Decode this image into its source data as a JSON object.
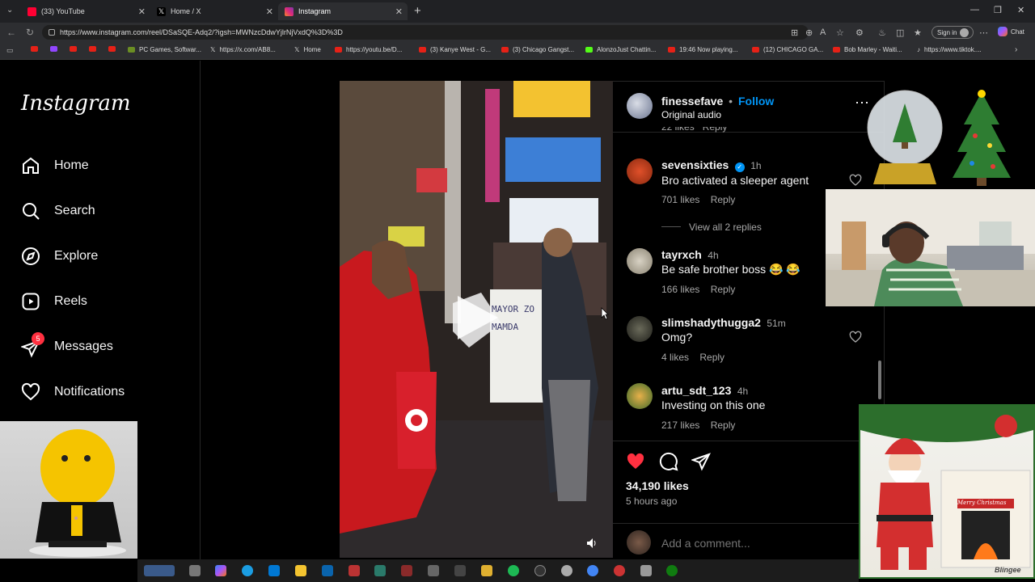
{
  "browser": {
    "tabs": [
      {
        "label": "(33) YouTube",
        "color": "#ff0033"
      },
      {
        "label": "Home / X",
        "color": "#ffffff"
      },
      {
        "label": "Instagram",
        "color": "#e1306c"
      }
    ],
    "url": "https://www.instagram.com/reel/DSaSQE-Adq2/?igsh=MWNzcDdwYjlrNjVxdQ%3D%3D",
    "signin_label": "Sign in",
    "chat_label": "Chat",
    "bookmarks": [
      "PC Games, Softwar...",
      "https://x.com/AB8...",
      "Home",
      "https://youtu.be/D...",
      "(3) Kanye West - G...",
      "(3) Chicago Gangst...",
      "AlonzoJust Chattin...",
      "19:46 Now playing...",
      "(12) CHICAGO GA...",
      "Bob Marley - Waiti...",
      "https://www.tiktok...."
    ]
  },
  "sidebar": {
    "logo": "Instagram",
    "items": [
      {
        "label": "Home",
        "icon": "home-icon"
      },
      {
        "label": "Search",
        "icon": "search-icon"
      },
      {
        "label": "Explore",
        "icon": "explore-icon"
      },
      {
        "label": "Reels",
        "icon": "reels-icon"
      },
      {
        "label": "Messages",
        "icon": "messages-icon"
      },
      {
        "label": "Notifications",
        "icon": "heart-icon"
      }
    ],
    "messages_badge": "5"
  },
  "post": {
    "username": "finessefave",
    "follow_label": "Follow",
    "separator": "•",
    "audio": "Original audio",
    "partial_row": "22 likes   Reply",
    "comments": [
      {
        "user": "sevensixties",
        "verified": true,
        "time": "1h",
        "text": "Bro activated a sleeper agent",
        "likes": "701 likes",
        "reply": "Reply",
        "view_replies": "View all 2 replies"
      },
      {
        "user": "tayrxch",
        "verified": false,
        "time": "4h",
        "text": "Be safe brother boss 😂 😂",
        "likes": "166 likes",
        "reply": "Reply"
      },
      {
        "user": "slimshadythugga2",
        "verified": false,
        "time": "51m",
        "text": "Omg?",
        "likes": "4 likes",
        "reply": "Reply"
      },
      {
        "user": "artu_sdt_123",
        "verified": false,
        "time": "4h",
        "text": "Investing on this one",
        "likes": "217 likes",
        "reply": "Reply"
      }
    ],
    "likes_count": "34,190 likes",
    "posted_ago": "5 hours ago",
    "add_comment_placeholder": "Add a comment...",
    "video_sign_text": "MAYOR ZO MAMDA",
    "colors": {
      "like_red": "#ff3040",
      "link_blue": "#0095f6"
    }
  },
  "overlays": {
    "santa_card_text": "Merry Christmas",
    "santa_watermark": "Blingee"
  }
}
